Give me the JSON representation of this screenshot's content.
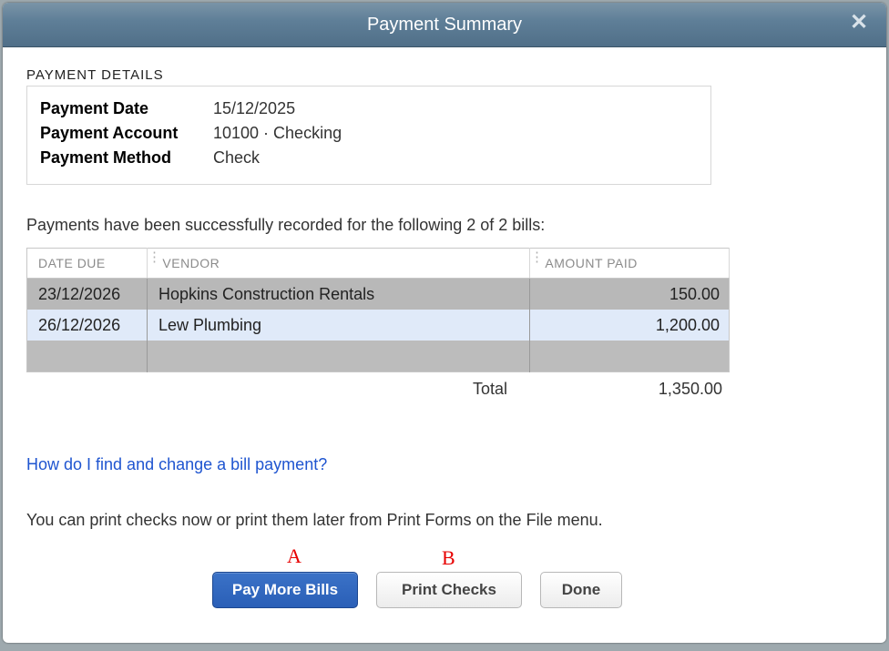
{
  "window": {
    "title": "Payment Summary"
  },
  "details": {
    "section_label": "PAYMENT DETAILS",
    "payment_date_label": "Payment Date",
    "payment_date_value": "15/12/2025",
    "payment_account_label": "Payment Account",
    "payment_account_value": "10100 · Checking",
    "payment_method_label": "Payment Method",
    "payment_method_value": "Check"
  },
  "success_message": "Payments have been successfully recorded for the following 2 of 2 bills:",
  "table": {
    "columns": {
      "date_due": "DATE DUE",
      "vendor": "VENDOR",
      "amount_paid": "AMOUNT PAID"
    },
    "rows": [
      {
        "date_due": "23/12/2026",
        "vendor": "Hopkins Construction Rentals",
        "amount_paid": "150.00"
      },
      {
        "date_due": "26/12/2026",
        "vendor": "Lew Plumbing",
        "amount_paid": "1,200.00"
      }
    ],
    "total_label": "Total",
    "total_value": "1,350.00"
  },
  "help_link": "How do I find and change a bill payment?",
  "print_hint": "You can print checks now or print them later from Print Forms on the File menu.",
  "annotations": {
    "a": "A",
    "b": "B"
  },
  "buttons": {
    "pay_more_bills": "Pay More Bills",
    "print_checks": "Print Checks",
    "done": "Done"
  }
}
